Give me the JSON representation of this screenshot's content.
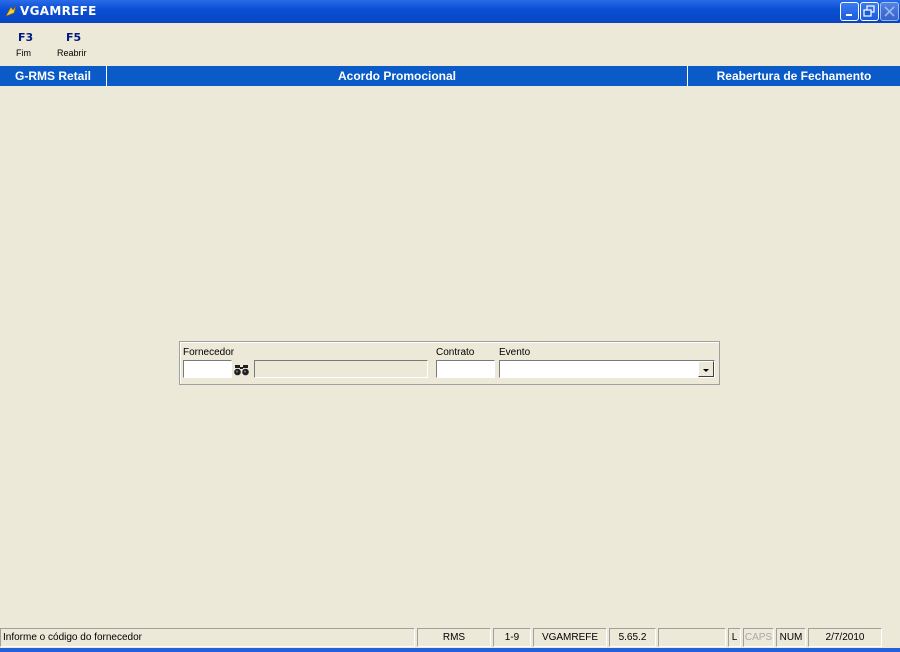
{
  "window": {
    "title": "VGAMREFE"
  },
  "toolbar": {
    "items": [
      {
        "key": "F3",
        "label": "Fim"
      },
      {
        "key": "F5",
        "label": "Reabrir"
      }
    ]
  },
  "header": {
    "left": "G-RMS Retail",
    "center": "Acordo Promocional",
    "right": "Reabertura de Fechamento"
  },
  "form": {
    "fornecedor_label": "Fornecedor",
    "fornecedor_value": "",
    "fornecedor_name": "",
    "contrato_label": "Contrato",
    "contrato_value": "",
    "evento_label": "Evento",
    "evento_value": ""
  },
  "status": {
    "message": "Informe o código do fornecedor",
    "system": "RMS",
    "range": "1-9",
    "program": "VGAMREFE",
    "version": "5.65.2",
    "empty": "",
    "l": "L",
    "caps": "CAPS",
    "num": "NUM",
    "date": "2/7/2010"
  },
  "colors": {
    "header_blue": "#0a5ac8",
    "titlebar_blue": "#0a4fd4",
    "background": "#ece9d8"
  }
}
